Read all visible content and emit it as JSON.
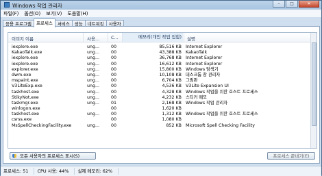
{
  "window": {
    "title": "Windows 작업 관리자",
    "minimize": "–",
    "maximize": "□",
    "close": "✕"
  },
  "menu": [
    "파일(F)",
    "옵션(O)",
    "보기(V)",
    "도움말(H)"
  ],
  "tabs": [
    "응용 프로그램",
    "프로세스",
    "서비스",
    "성능",
    "네트워킹",
    "사용자"
  ],
  "active_tab": 1,
  "columns": {
    "name": "이미지 이름",
    "user": "사용...",
    "cpu": "C...",
    "memory": "메모리(개인 작업 집합)",
    "description": "설명"
  },
  "processes": [
    {
      "name": "iexplore.exe",
      "user": "ung...",
      "cpu": "00",
      "mem": "85,516 KB",
      "desc": "Internet Explorer"
    },
    {
      "name": "KakaoTalk.exe",
      "user": "ung...",
      "cpu": "00",
      "mem": "43,388 KB",
      "desc": "KakaoTalk"
    },
    {
      "name": "iexplore.exe",
      "user": "ung...",
      "cpu": "00",
      "mem": "36,768 KB",
      "desc": "Internet Explorer"
    },
    {
      "name": "iexplore.exe",
      "user": "ung...",
      "cpu": "00",
      "mem": "16,612 KB",
      "desc": "Internet Explorer"
    },
    {
      "name": "explorer.exe",
      "user": "ung...",
      "cpu": "00",
      "mem": "15,800 KB",
      "desc": "Windows 탐색기"
    },
    {
      "name": "dwm.exe",
      "user": "ung...",
      "cpu": "00",
      "mem": "10,108 KB",
      "desc": "데스크톱 창 관리자"
    },
    {
      "name": "mspaint.exe",
      "user": "ung...",
      "cpu": "00",
      "mem": "6,704 KB",
      "desc": "그림판"
    },
    {
      "name": "V3LiteExp.exe",
      "user": "ung...",
      "cpu": "00",
      "mem": "4,536 KB",
      "desc": "V3Lite Expansion UI"
    },
    {
      "name": "taskhost.exe",
      "user": "ung...",
      "cpu": "00",
      "mem": "4,328 KB",
      "desc": "Windows 작업을 위한 호스트 프로세스"
    },
    {
      "name": "StikyNot.exe",
      "user": "ung...",
      "cpu": "00",
      "mem": "4,232 KB",
      "desc": "스티커 메모"
    },
    {
      "name": "taskmgr.exe",
      "user": "ung...",
      "cpu": "01",
      "mem": "2,168 KB",
      "desc": "Windows 작업 관리자"
    },
    {
      "name": "winlogon.exe",
      "user": "",
      "cpu": "00",
      "mem": "1,620 KB",
      "desc": ""
    },
    {
      "name": "taskhost.exe",
      "user": "ung...",
      "cpu": "00",
      "mem": "1,312 KB",
      "desc": "Windows 작업을 위한 호스트 프로세스"
    },
    {
      "name": "csrss.exe",
      "user": "",
      "cpu": "00",
      "mem": "1,080 KB",
      "desc": ""
    },
    {
      "name": "MsSpellCheckingFacility.exe",
      "user": "ung...",
      "cpu": "00",
      "mem": "852 KB",
      "desc": "Microsoft Spell Checking Facility"
    }
  ],
  "buttons": {
    "show_all": "모든 사용자의 프로세스 표시(S)",
    "end_process": "프로세스 끝내기(E)"
  },
  "status": {
    "processes": "프로세스: 51",
    "cpu": "CPU 사용: 44%",
    "memory": "실제 메모리: 62%"
  }
}
